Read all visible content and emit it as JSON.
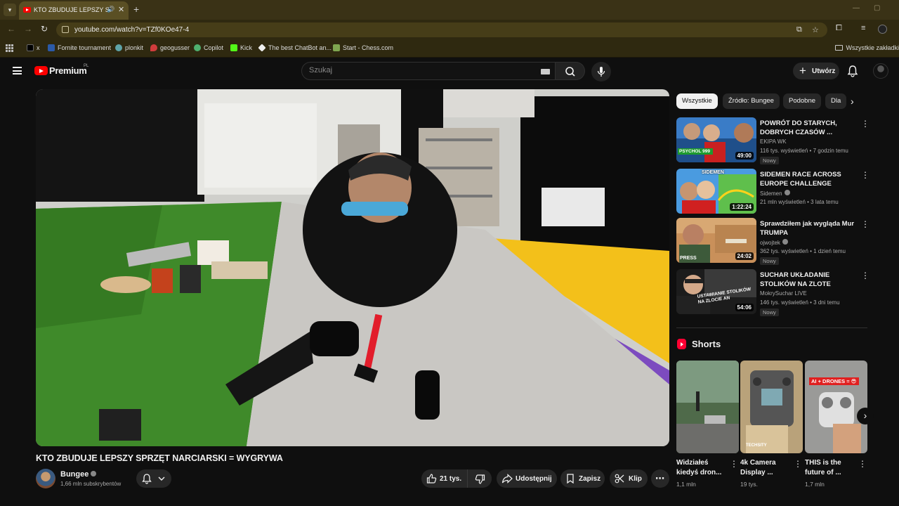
{
  "browser": {
    "tab_title": "KTO ZBUDUJE LEPSZY SPRZĘT NARCIARSKI = WYGRYWA",
    "url": "youtube.com/watch?v=TZf0KOe47-4",
    "bookmarks": [
      "x",
      "Fornite tournament",
      "plonkit",
      "geogusser",
      "Copilot",
      "Kick",
      "The best ChatBot an...",
      "Start - Chess.com"
    ],
    "all_bookmarks": "Wszystkie zakładki",
    "colors": {
      "frame": "#3a3216",
      "toolbar": "#2f2910",
      "omnibox": "#463d18"
    }
  },
  "header": {
    "brand": "Premium",
    "region": "PL",
    "search_placeholder": "Szukaj",
    "create_label": "Utwórz"
  },
  "video": {
    "title": "KTO ZBUDUJE LEPSZY SPRZĘT NARCIARSKI = WYGRYWA",
    "channel": "Bungee",
    "subscribers": "1,66 mln subskrybentów",
    "likes": "21 tys.",
    "share_label": "Udostępnij",
    "save_label": "Zapisz",
    "clip_label": "Klip"
  },
  "chips": [
    "Wszystkie",
    "Źródło: Bungee",
    "Podobne",
    "Dla"
  ],
  "recommendations": [
    {
      "title": "POWRÓT DO STARYCH, DOBRYCH CZASÓW ...",
      "channel": "EKIPA WK",
      "meta": "116 tys. wyświetleń • 7 godzin temu",
      "badge": "Nowy",
      "duration": "49:00",
      "thumb_text": "PSYCHOL 999"
    },
    {
      "title": "SIDEMEN RACE ACROSS EUROPE CHALLENGE",
      "channel": "Sidemen",
      "meta": "21 mln wyświetleń • 3 lata temu",
      "badge": "",
      "duration": "1:22:24",
      "thumb_text": "SIDEMEN"
    },
    {
      "title": "Sprawdziłem jak wygląda Mur TRUMPA",
      "channel": "ojwojtek",
      "meta": "362 tys. wyświetleń • 1 dzień temu",
      "badge": "Nowy",
      "duration": "24:02",
      "thumb_text": "PRESS"
    },
    {
      "title": "SUCHAR UKŁADANIE STOLIKÓW NA ZLOTE ANTOSI...",
      "channel": "MokrySuchar LIVE",
      "meta": "146 tys. wyświetleń • 3 dni temu",
      "badge": "Nowy",
      "duration": "54:06",
      "thumb_text": "USTAWIANIE STOLIKÓW NA ZLOCIE AN"
    }
  ],
  "shorts": {
    "heading": "Shorts",
    "items": [
      {
        "title": "Widziałeś kiedyś dron...",
        "views": "1,1 mln",
        "thumb_text": ""
      },
      {
        "title": "4k Camera Display ...",
        "views": "19 tys.",
        "thumb_text": "TECHSITY"
      },
      {
        "title": "THIS is the future of ...",
        "views": "1,7 mln",
        "thumb_text": "AI + DRONES = 😎"
      }
    ]
  },
  "icons": [
    "tab-list-icon",
    "youtube-favicon",
    "audio-icon",
    "close-icon",
    "plus-icon",
    "back-icon",
    "forward-icon",
    "reload-icon",
    "site-info-icon",
    "cast-icon",
    "star-icon",
    "extensions-icon",
    "menu-icon",
    "apps-icon",
    "hamburger-icon",
    "youtube-logo",
    "keyboard-icon",
    "search-icon",
    "mic-icon",
    "bell-icon",
    "thumbs-up-icon",
    "thumbs-down-icon",
    "share-icon",
    "save-icon",
    "clip-icon",
    "more-icon",
    "chevron-right-icon",
    "shorts-icon"
  ]
}
